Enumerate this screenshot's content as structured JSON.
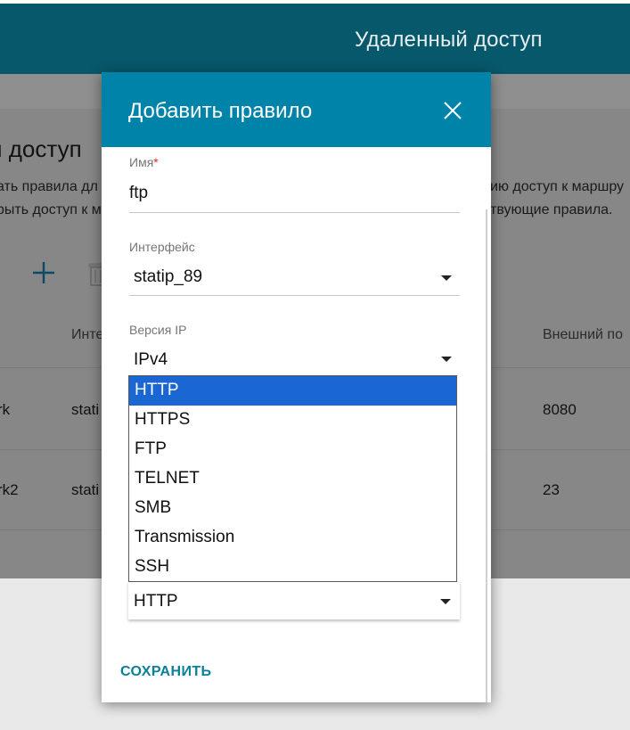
{
  "topbar": {
    "title": "Удаленный доступ"
  },
  "page": {
    "heading": "й доступ",
    "desc_line1_left": "ать правила дл",
    "desc_line1_right": "ию доступ к маршру",
    "desc_line2_left": "рыть доступ к м",
    "desc_line2_right": "твующие правила.",
    "columns": {
      "interface": "Инте",
      "external_port": "Внешний по"
    },
    "rows": [
      {
        "name": "rk",
        "interface": "stati",
        "external_port": "8080"
      },
      {
        "name": "rk2",
        "interface": "stati",
        "external_port": "23"
      }
    ]
  },
  "modal": {
    "title": "Добавить правило",
    "name_label": "Имя",
    "required_mark": "*",
    "name_value": "ftp",
    "interface_label": "Интерфейс",
    "interface_value": "statip_89",
    "ip_version_label": "Версия IP",
    "ip_version_value": "IPv4",
    "service_options": [
      "HTTP",
      "HTTPS",
      "FTP",
      "TELNET",
      "SMB",
      "Transmission",
      "SSH"
    ],
    "highlighted_option": "HTTP",
    "service_value": "HTTP",
    "save_label": "СОХРАНИТЬ"
  },
  "colors": {
    "header_dark": "#07586a",
    "modal_header": "#0083a8",
    "accent": "#0a7f9c",
    "selection": "#1a66d2",
    "required": "#e0302a"
  },
  "icons": {
    "add": "plus-icon",
    "delete": "trash-icon",
    "close": "close-icon",
    "dropdown": "caret-down-icon"
  }
}
